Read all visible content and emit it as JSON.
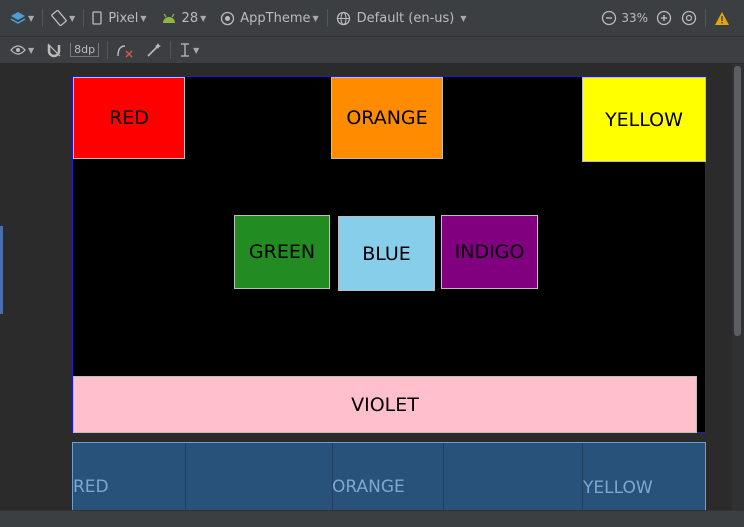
{
  "toolbar": {
    "device": "Pixel",
    "api_level": "28",
    "theme": "AppTheme",
    "locale": "Default (en-us)",
    "zoom": "33%",
    "margin": "8dp"
  },
  "design": {
    "boxes": {
      "red": {
        "label": "RED",
        "color": "#ff0000"
      },
      "orange": {
        "label": "ORANGE",
        "color": "#ff8c00"
      },
      "yellow": {
        "label": "YELLOW",
        "color": "#ffff00"
      },
      "green": {
        "label": "GREEN",
        "color": "#228b22"
      },
      "blue": {
        "label": "BLUE",
        "color": "#87ceeb"
      },
      "indigo": {
        "label": "INDIGO",
        "color": "#800080"
      },
      "violet": {
        "label": "VIOLET",
        "color": "#ffc0cb"
      }
    }
  },
  "blueprint": {
    "labels": {
      "red": "RED",
      "orange": "ORANGE",
      "yellow": "YELLOW"
    }
  }
}
